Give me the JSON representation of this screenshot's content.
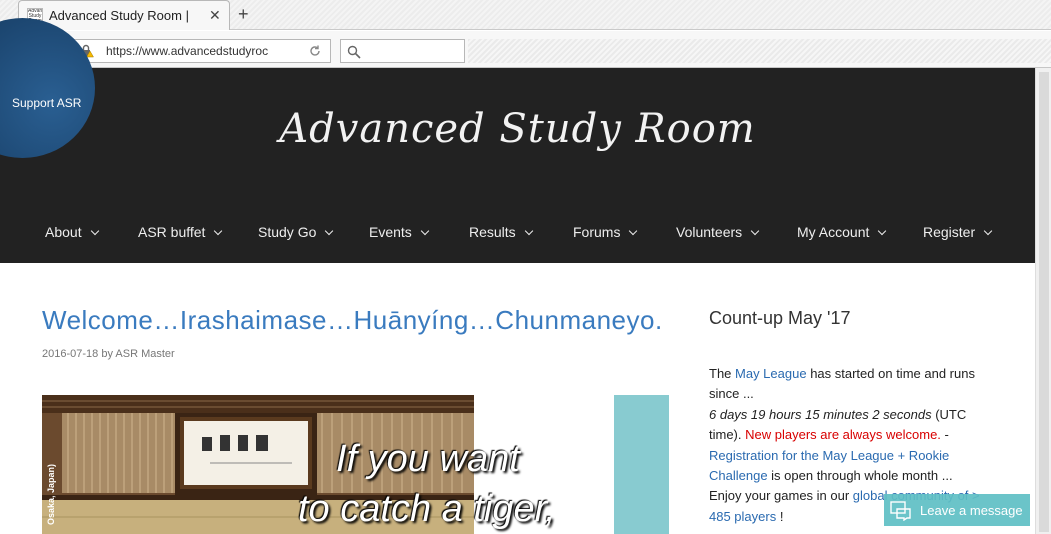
{
  "browser": {
    "tab_title": "Advanced Study Room |",
    "favicon_text": "Advanced Study Room",
    "url": "https://www.advancedstudyroc",
    "search_placeholder": ""
  },
  "header": {
    "support_label": "Support ASR",
    "site_title": "Advanced Study Room",
    "menu": [
      {
        "label": "About"
      },
      {
        "label": "ASR buffet"
      },
      {
        "label": "Study Go"
      },
      {
        "label": "Events"
      },
      {
        "label": "Results"
      },
      {
        "label": "Forums"
      },
      {
        "label": "Volunteers"
      },
      {
        "label": "My Account"
      },
      {
        "label": "Register"
      }
    ]
  },
  "post": {
    "title": "Welcome…Irashaimase…Huānyíng…Chunmaneyo.",
    "date": "2016-07-18",
    "by": "by",
    "author": "ASR Master",
    "image_side_caption": "Osaka, Japan)",
    "overlay_line1": "If you want",
    "overlay_line2": "to catch a tiger,"
  },
  "sidebar": {
    "widget_title": "Count-up May '17",
    "t1": "The ",
    "link_may_league": "May League",
    "t2": " has started on time and runs since ...",
    "countdown": "6 days 19 hours 15 minutes 2 seconds",
    "t3": " (UTC time). ",
    "new_players": "New players are always welcome.",
    "t4": " - ",
    "link_registration": "Registration for the May League + Rookie Challenge",
    "t5": " is open through whole month ...",
    "t6": "Enjoy your games in our ",
    "link_community": "global community of > 485 players",
    "t7": " !"
  },
  "chat": {
    "label": "Leave a message"
  },
  "colors": {
    "header_bg": "#222222",
    "link": "#3a7bbf",
    "alert": "#d80000",
    "chat_bg": "#5fbfc5"
  }
}
